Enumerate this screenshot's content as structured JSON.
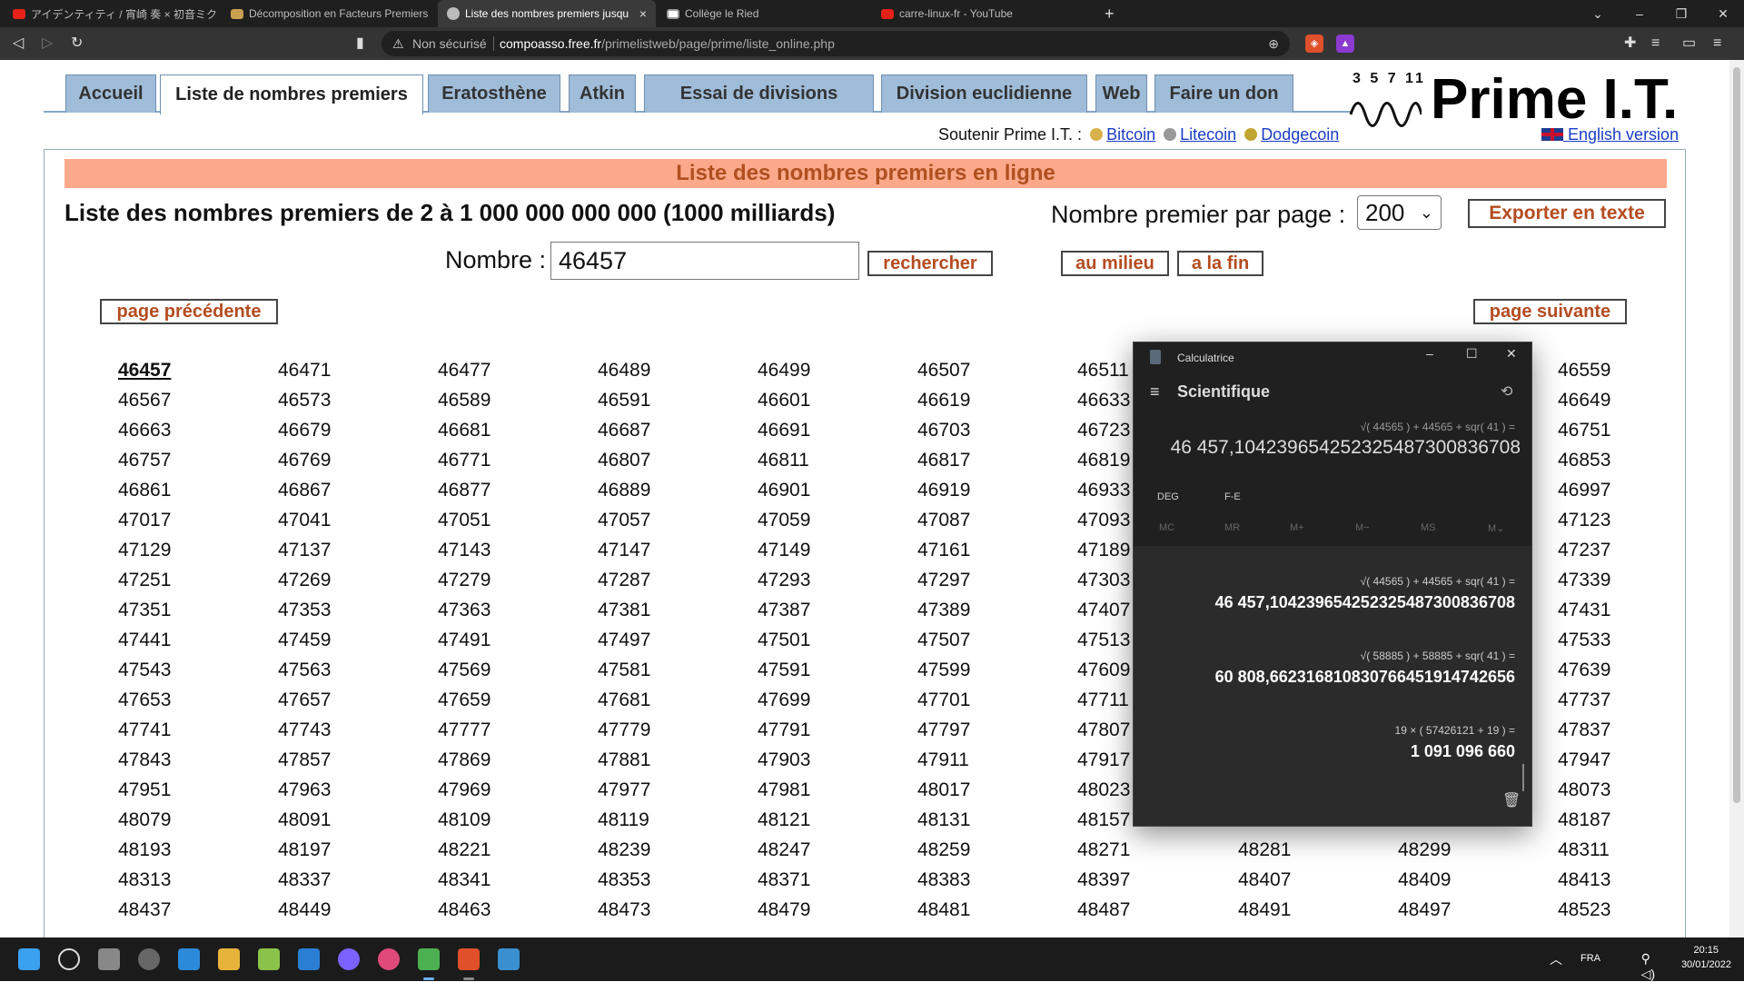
{
  "browser": {
    "tabs": [
      {
        "label": "アイデンティティ / 宵崎 奏 × 初音ミク",
        "icon": "youtube-icon"
      },
      {
        "label": "Décomposition en Facteurs Premiers",
        "icon": "site-icon"
      },
      {
        "label": "Liste des nombres premiers jusqu",
        "icon": "globe-icon"
      },
      {
        "label": "Collège le Ried",
        "icon": "doc-icon"
      },
      {
        "label": "carre-linux-fr - YouTube",
        "icon": "youtube-icon"
      }
    ],
    "new_tab": "+",
    "url": {
      "security": "Non sécurisé",
      "host": "compoasso.free.fr",
      "path": "/primelistweb/page/prime/liste_online.php"
    }
  },
  "site": {
    "nav": [
      "Accueil",
      "Liste de nombres premiers",
      "Eratosthène",
      "Atkin",
      "Essai de divisions",
      "Division euclidienne",
      "Web",
      "Faire un don"
    ],
    "logo_numbers": "3 5 7 11",
    "logo_name": "Prime I.T.",
    "support_label": "Soutenir Prime I.T. :",
    "support_links": [
      "Bitcoin",
      "Litecoin",
      "Dodgecoin"
    ],
    "english": "English version",
    "banner": "Liste des nombres premiers en ligne",
    "list_title": "Liste des nombres premiers de 2 à 1 000 000 000 000 (1000 milliards)",
    "per_page_label": "Nombre premier par page :",
    "per_page_value": "200",
    "export_button": "Exporter en texte",
    "number_label": "Nombre :",
    "number_value": "46457",
    "search_button": "rechercher",
    "middle_button": "au milieu",
    "end_button": "a la fin",
    "prev_button": "page précédente",
    "next_button": "page suivante",
    "primes": [
      [
        "46457",
        "46471",
        "46477",
        "46489",
        "46499",
        "46507",
        "46511",
        "",
        "",
        "46559"
      ],
      [
        "46567",
        "46573",
        "46589",
        "46591",
        "46601",
        "46619",
        "46633",
        "",
        "",
        "46649"
      ],
      [
        "46663",
        "46679",
        "46681",
        "46687",
        "46691",
        "46703",
        "46723",
        "",
        "",
        "46751"
      ],
      [
        "46757",
        "46769",
        "46771",
        "46807",
        "46811",
        "46817",
        "46819",
        "",
        "",
        "46853"
      ],
      [
        "46861",
        "46867",
        "46877",
        "46889",
        "46901",
        "46919",
        "46933",
        "",
        "",
        "46997"
      ],
      [
        "47017",
        "47041",
        "47051",
        "47057",
        "47059",
        "47087",
        "47093",
        "",
        "",
        "47123"
      ],
      [
        "47129",
        "47137",
        "47143",
        "47147",
        "47149",
        "47161",
        "47189",
        "",
        "",
        "47237"
      ],
      [
        "47251",
        "47269",
        "47279",
        "47287",
        "47293",
        "47297",
        "47303",
        "",
        "",
        "47339"
      ],
      [
        "47351",
        "47353",
        "47363",
        "47381",
        "47387",
        "47389",
        "47407",
        "",
        "",
        "47431"
      ],
      [
        "47441",
        "47459",
        "47491",
        "47497",
        "47501",
        "47507",
        "47513",
        "",
        "",
        "47533"
      ],
      [
        "47543",
        "47563",
        "47569",
        "47581",
        "47591",
        "47599",
        "47609",
        "",
        "",
        "47639"
      ],
      [
        "47653",
        "47657",
        "47659",
        "47681",
        "47699",
        "47701",
        "47711",
        "",
        "",
        "47737"
      ],
      [
        "47741",
        "47743",
        "47777",
        "47779",
        "47791",
        "47797",
        "47807",
        "",
        "",
        "47837"
      ],
      [
        "47843",
        "47857",
        "47869",
        "47881",
        "47903",
        "47911",
        "47917",
        "",
        "",
        "47947"
      ],
      [
        "47951",
        "47963",
        "47969",
        "47977",
        "47981",
        "48017",
        "48023",
        "",
        "",
        "48073"
      ],
      [
        "48079",
        "48091",
        "48109",
        "48119",
        "48121",
        "48131",
        "48157",
        "",
        "",
        "48187"
      ],
      [
        "48193",
        "48197",
        "48221",
        "48239",
        "48247",
        "48259",
        "48271",
        "48281",
        "48299",
        "48311"
      ],
      [
        "48313",
        "48337",
        "48341",
        "48353",
        "48371",
        "48383",
        "48397",
        "48407",
        "48409",
        "48413"
      ],
      [
        "48437",
        "48449",
        "48463",
        "48473",
        "48479",
        "48481",
        "48487",
        "48491",
        "48497",
        "48523"
      ]
    ]
  },
  "calculator": {
    "title": "Calculatrice",
    "mode": "Scientifique",
    "expression": "√( 44565 )  +  44565  +  sqr( 41 )  =",
    "result": "46 457,104239654252325487300836708",
    "angle": "DEG",
    "fe": "F-E",
    "memory": [
      "MC",
      "MR",
      "M+",
      "M−",
      "MS",
      "M⌄"
    ],
    "history": [
      {
        "expr": "√( 44565 )   +   44565   +   sqr( 41 )  =",
        "result": "46 457,104239654252325487300836708"
      },
      {
        "expr": "√( 58885 )   +   58885   +   sqr( 41 )  =",
        "result": "60 808,662316810830766451914742656"
      },
      {
        "expr": "19   ×   ( 57426121   +   19 )  =",
        "result": "1 091 096 660"
      }
    ]
  },
  "taskbar": {
    "lang": "FRA",
    "time": "20:15",
    "date": "30/01/2022"
  }
}
